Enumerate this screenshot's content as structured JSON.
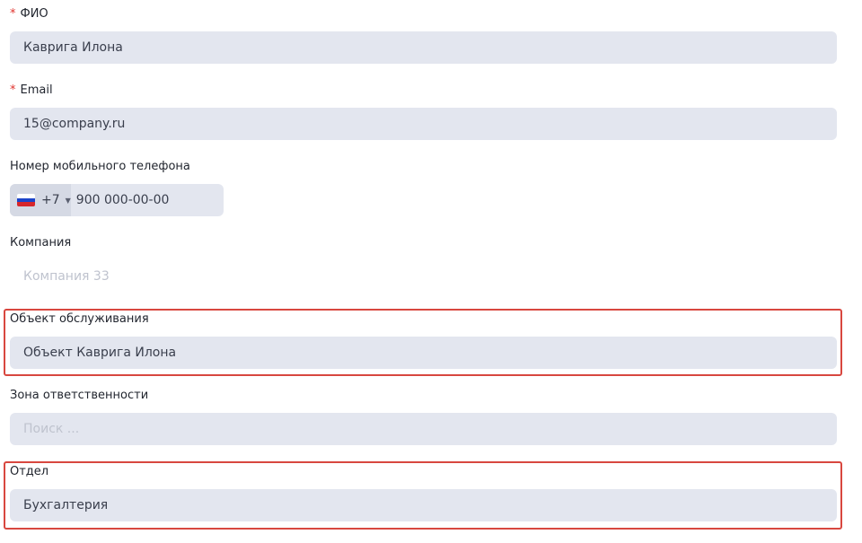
{
  "fields": {
    "fio": {
      "label": "ФИО",
      "value": "Каврига Илона",
      "required_mark": "*"
    },
    "email": {
      "label": "Email",
      "value": "15@company.ru",
      "required_mark": "*"
    },
    "phone": {
      "label": "Номер мобильного телефона",
      "dial_code": "+7",
      "placeholder": "900 000-00-00"
    },
    "company": {
      "label": "Компания",
      "placeholder": "Компания 33"
    },
    "service_object": {
      "label": "Объект обслуживания",
      "value": "Объект Каврига Илона"
    },
    "responsibility_zone": {
      "label": "Зона ответственности",
      "placeholder": "Поиск ..."
    },
    "department": {
      "label": "Отдел",
      "value": "Бухгалтерия"
    }
  },
  "colors": {
    "required": "#e0332e",
    "highlight": "#d8473f",
    "input_bg": "#e3e6ef"
  },
  "icons": {
    "flag": "russia-flag-icon",
    "caret": "caret-down-icon"
  }
}
